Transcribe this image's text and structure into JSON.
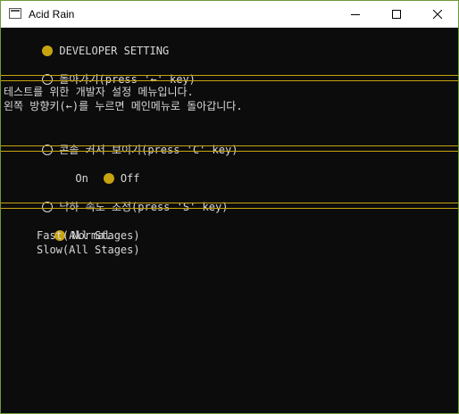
{
  "window": {
    "title": "Acid Rain",
    "minimize_icon": "minimize-icon",
    "maximize_icon": "maximize-icon",
    "close_icon": "close-icon"
  },
  "colors": {
    "background": "#0c0c0c",
    "text": "#d8d8d8",
    "accent": "#c7a30f"
  },
  "menu": {
    "header": "DEVELOPER SETTING",
    "back": "돌아가기(press '←' key)",
    "description": [
      "테스트를 위한 개발자 설정 메뉴입니다.",
      "왼쪽 방향키(←)를 누르면 메인메뉴로 돌아갑니다."
    ],
    "cursor_setting": {
      "label": "콘솔 커서 보이기(press 'C' key)",
      "options": [
        "On",
        "Off"
      ],
      "selected": "Off"
    },
    "speed_setting": {
      "label": "낙하 속도 조정(press 'S' key)",
      "options": [
        "Normal",
        "Fast(All Stages)",
        "Slow(All Stages)"
      ],
      "selected": "Normal"
    }
  }
}
